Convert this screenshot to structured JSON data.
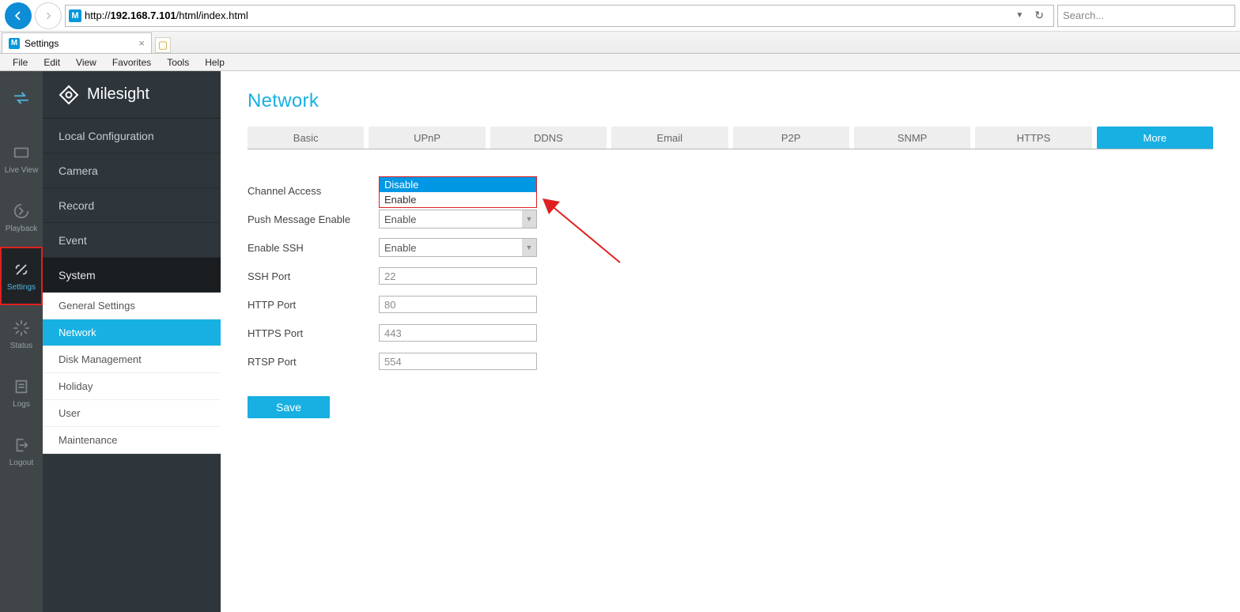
{
  "browser": {
    "url_pre": "http://",
    "url_host": "192.168.7.101",
    "url_path": "/html/index.html",
    "search_placeholder": "Search...",
    "tab_title": "Settings",
    "menus": [
      "File",
      "Edit",
      "View",
      "Favorites",
      "Tools",
      "Help"
    ]
  },
  "rail": {
    "items": [
      "",
      "Live View",
      "Playback",
      "Settings",
      "Status",
      "Logs",
      "Logout"
    ],
    "active_index": 3
  },
  "brand": "Milesight",
  "sidebar": {
    "items": [
      "Local Configuration",
      "Camera",
      "Record",
      "Event",
      "System"
    ],
    "active_index": 4,
    "sub_items": [
      "General Settings",
      "Network",
      "Disk Management",
      "Holiday",
      "User",
      "Maintenance"
    ],
    "sub_active_index": 1
  },
  "page": {
    "title": "Network",
    "tabs": [
      "Basic",
      "UPnP",
      "DDNS",
      "Email",
      "P2P",
      "SNMP",
      "HTTPS",
      "More"
    ],
    "active_tab_index": 7,
    "save_label": "Save"
  },
  "form": {
    "channel_access": {
      "label": "Channel Access",
      "options": [
        "Disable",
        "Enable"
      ],
      "selected_index": 0
    },
    "push_message": {
      "label": "Push Message Enable",
      "value": "Enable"
    },
    "enable_ssh": {
      "label": "Enable SSH",
      "value": "Enable"
    },
    "ssh_port": {
      "label": "SSH Port",
      "value": "22"
    },
    "http_port": {
      "label": "HTTP Port",
      "value": "80"
    },
    "https_port": {
      "label": "HTTPS Port",
      "value": "443"
    },
    "rtsp_port": {
      "label": "RTSP Port",
      "value": "554"
    }
  }
}
